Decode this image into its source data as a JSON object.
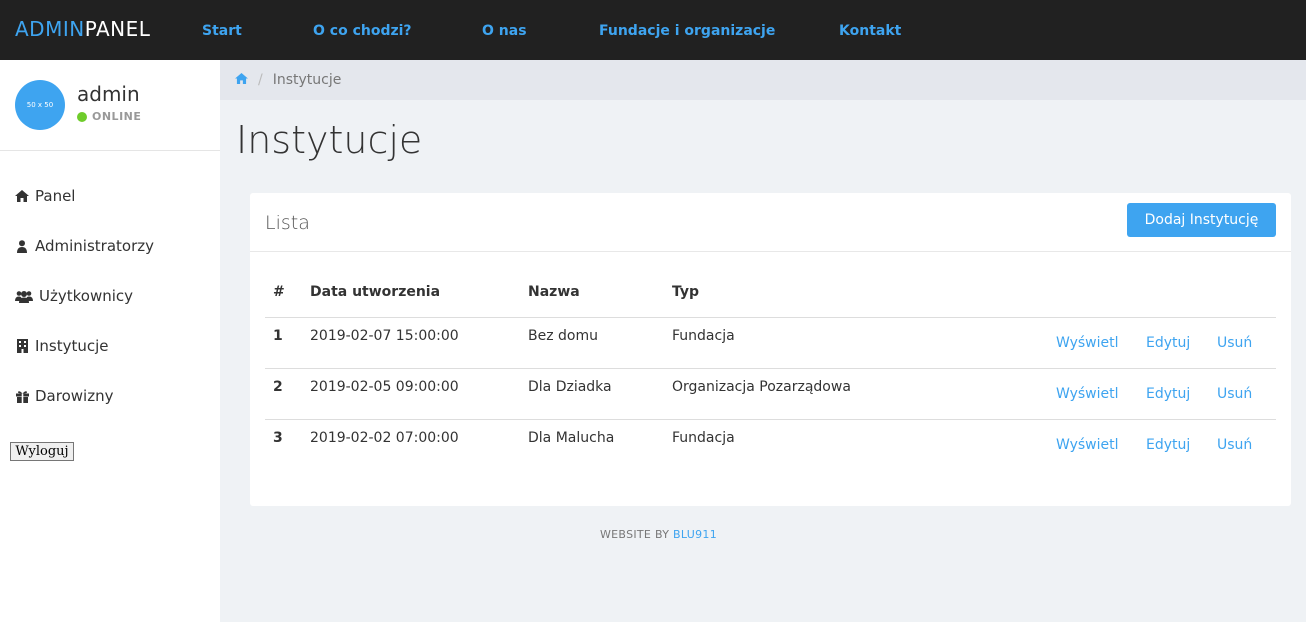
{
  "brand": {
    "part1": "ADMIN",
    "part2": "PANEL"
  },
  "nav": [
    {
      "label": "Start"
    },
    {
      "label": "O co chodzi?"
    },
    {
      "label": "O nas"
    },
    {
      "label": "Fundacje i organizacje"
    },
    {
      "label": "Kontakt"
    }
  ],
  "user": {
    "avatar_text": "50 x 50",
    "name": "admin",
    "status": "ONLINE"
  },
  "sidebar": {
    "items": [
      {
        "label": "Panel",
        "icon": "home-icon"
      },
      {
        "label": "Administratorzy",
        "icon": "user-icon"
      },
      {
        "label": "Użytkownicy",
        "icon": "users-icon"
      },
      {
        "label": "Instytucje",
        "icon": "building-icon"
      },
      {
        "label": "Darowizny",
        "icon": "gift-icon"
      }
    ],
    "logout_label": "Wyloguj"
  },
  "breadcrumb": {
    "current": "Instytucje",
    "separator": "/"
  },
  "page": {
    "title": "Instytucje"
  },
  "card": {
    "title": "Lista",
    "add_button": "Dodaj Instytucję",
    "columns": [
      "#",
      "Data utworzenia",
      "Nazwa",
      "Typ"
    ],
    "rows": [
      {
        "num": "1",
        "date": "2019-02-07 15:00:00",
        "name": "Bez domu",
        "type": "Fundacja"
      },
      {
        "num": "2",
        "date": "2019-02-05 09:00:00",
        "name": "Dla Dziadka",
        "type": "Organizacja Pozarządowa"
      },
      {
        "num": "3",
        "date": "2019-02-02 07:00:00",
        "name": "Dla Malucha",
        "type": "Fundacja"
      }
    ],
    "actions": {
      "view": "Wyświetl",
      "edit": "Edytuj",
      "delete": "Usuń"
    }
  },
  "footer": {
    "text": "WEBSITE BY",
    "link": "BLU911"
  },
  "colors": {
    "accent": "#3ea4f0",
    "topbar": "#212121",
    "online": "#6fcc2b"
  }
}
